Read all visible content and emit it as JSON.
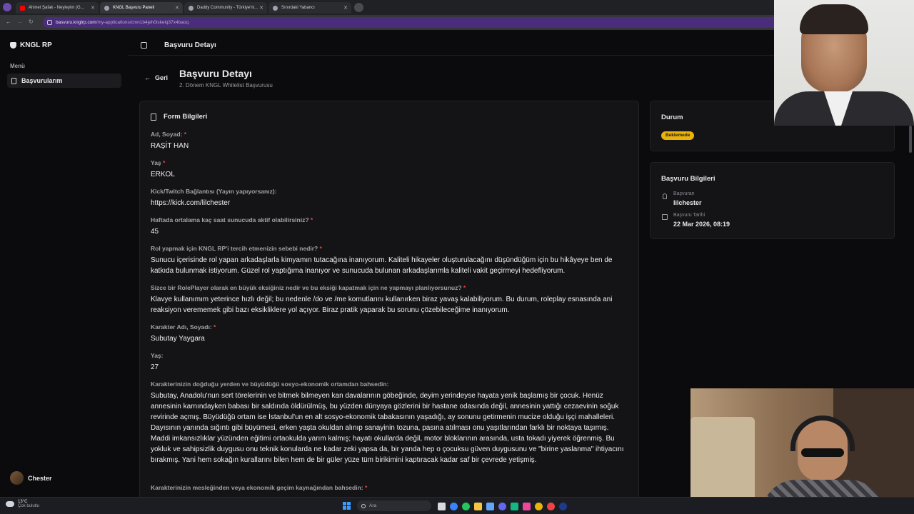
{
  "browser": {
    "tabs": [
      {
        "title": "Ahmet Şafak - Neyleyim (G...",
        "icon_color": "#ff0000"
      },
      {
        "title": "KNGL Başvuru Paneli",
        "icon_color": "#9ca3af"
      },
      {
        "title": "Daddy Community - Türkiye'ni...",
        "icon_color": "#9ca3af"
      },
      {
        "title": "Sınırdaki Yabancı",
        "icon_color": "#9ca3af"
      }
    ],
    "url_host": "basvuru.knglrp.com",
    "url_path": "/my-applications/cmn1b4jeh0iskelq37x4baoq"
  },
  "sidebar": {
    "brand": "KNGL RP",
    "section": "Menü",
    "items": [
      {
        "label": "Başvurularım"
      }
    ],
    "user": "Chester"
  },
  "header": {
    "title": "Başvuru Detayı"
  },
  "page": {
    "back": "Geri",
    "title": "Başvuru Detayı",
    "subtitle": "2. Dönem KNGL Whitelist Başvurusu"
  },
  "form": {
    "title": "Form Bilgileri",
    "fields": [
      {
        "q": "Ad, Soyad:",
        "req": "*",
        "a": "RAŞİT HAN"
      },
      {
        "q": "Yaş",
        "req": "*",
        "a": "ERKOL"
      },
      {
        "q": "Kick/Twitch Bağlantısı (Yayın yapıyorsanız):",
        "req": "",
        "a": "https://kick.com/lilchester"
      },
      {
        "q": "Haftada ortalama kaç saat sunucuda aktif olabilirsiniz?",
        "req": "*",
        "a": "45"
      },
      {
        "q": "Rol yapmak için KNGL RP'i tercih etmenizin sebebi nedir?",
        "req": "*",
        "a": "Sunucu içerisinde rol yapan arkadaşlarla kimyamın tutacağına inanıyorum. Kaliteli hikayeler oluşturulacağını düşündüğüm için bu hikâyeye ben de katkıda bulunmak istiyorum. Güzel rol yaptığıma inanıyor ve sunucuda bulunan arkadaşlarımla kaliteli vakit geçirmeyi hedefliyorum."
      },
      {
        "q": "Sizce bir RolePlayer olarak en büyük eksiğiniz nedir ve bu eksiği kapatmak için ne yapmayı planlıyorsunuz?",
        "req": "*",
        "a": "Klavye kullanımım yeterince hızlı değil; bu nedenle /do ve /me komutlarını kullanırken biraz yavaş kalabiliyorum. Bu durum, roleplay esnasında ani reaksiyon verememek gibi bazı eksikliklere yol açıyor. Biraz pratik yaparak bu sorunu çözebileceğime inanıyorum."
      },
      {
        "q": "Karakter Adı, Soyadı:",
        "req": "*",
        "a": "Subutay Yaygara"
      },
      {
        "q": "Yaş:",
        "req": "",
        "a": "27"
      },
      {
        "q": "Karakterinizin doğduğu yerden ve büyüdüğü sosyo-ekonomik ortamdan bahsedin:",
        "req": "",
        "a": "Subutay, Anadolu'nun sert törelerinin ve bitmek bilmeyen kan davalarının göbeğinde, deyim yerindeyse hayata yenik başlamış bir çocuk. Henüz annesinin karnındayken babası bir saldırıda öldürülmüş, bu yüzden dünyaya gözlerini bir hastane odasında değil, annesinin yattığı cezaevinin soğuk revirinde açmış. Büyüdüğü ortam ise İstanbul'un en alt sosyo-ekonomik tabakasının yaşadığı, ay sonunu getirmenin mucize olduğu işçi mahalleleri. Dayısının yanında sığıntı gibi büyümesi, erken yaşta okuldan alınıp sanayinin tozuna, pasına atılması onu yaşıtlarından farklı bir noktaya taşımış. Maddi imkansızlıklar yüzünden eğitimi ortaokulda yarım kalmış; hayatı okullarda değil, motor bloklarının arasında, usta tokadı yiyerek öğrenmiş. Bu yokluk ve sahipsizlik duygusu onu teknik konularda ne kadar zeki yapsa da, bir yanda hep o çocuksu güven duygusunu ve \"birine yaslanma\" ihtiyacını bırakmış. Yani hem sokağın kurallarını bilen hem de bir güler yüze tüm birikimini kaptıracak kadar saf bir çevrede yetişmiş."
      },
      {
        "q": "Karakterinizin mesleğinden veya ekonomik geçim kaynağından bahsedin:",
        "req": "*",
        "a": ""
      }
    ]
  },
  "status": {
    "title": "Durum",
    "badge": "Beklemede",
    "badge_color": "#eab308"
  },
  "info": {
    "title": "Başvuru Bilgileri",
    "applicant_label": "Başvuran",
    "applicant": "lilchester",
    "date_label": "Başvuru Tarihi",
    "date": "22 Mar 2026, 08:19"
  },
  "taskbar": {
    "weather_temp": "13°C",
    "weather_desc": "Çok bulutlu",
    "search_placeholder": "Ara"
  }
}
